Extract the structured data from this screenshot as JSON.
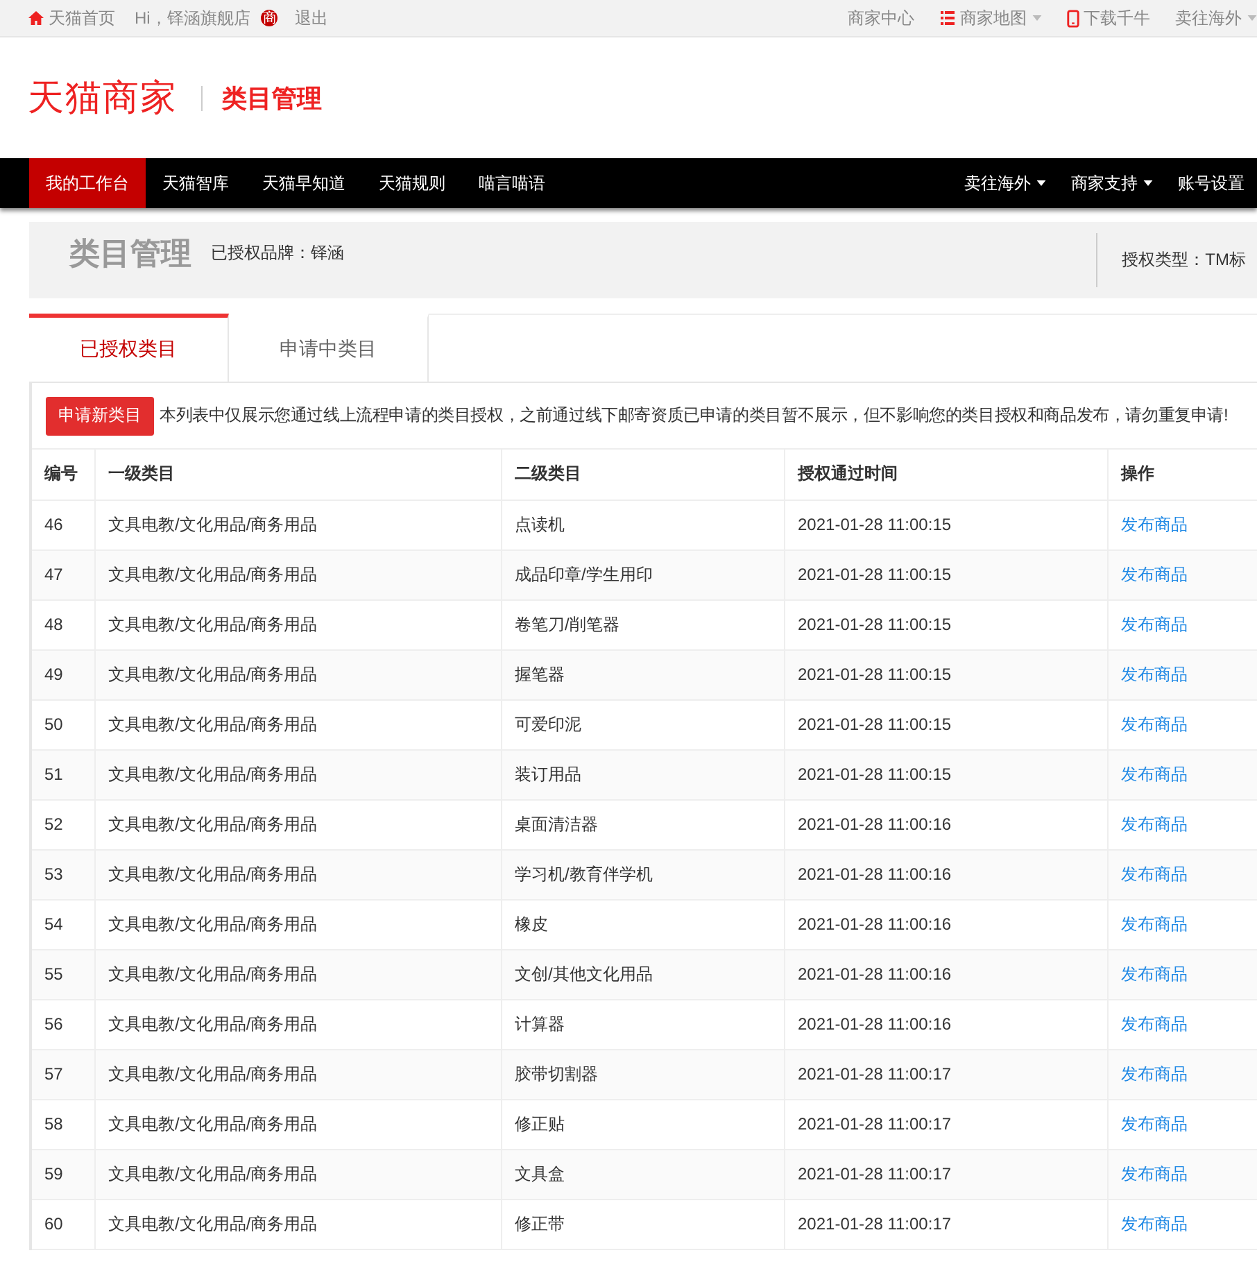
{
  "top_bar": {
    "left": [
      {
        "kind": "home",
        "label": "天猫首页"
      },
      {
        "kind": "text",
        "label": "Hi，铎涵旗舰店"
      },
      {
        "kind": "badge",
        "label": "商"
      },
      {
        "kind": "text",
        "label": "退出"
      }
    ],
    "right": [
      {
        "kind": "text",
        "label": "商家中心",
        "dropdown": false
      },
      {
        "kind": "list",
        "label": "商家地图",
        "dropdown": true
      },
      {
        "kind": "phone",
        "label": "下载千牛",
        "dropdown": false
      },
      {
        "kind": "text",
        "label": "卖往海外",
        "dropdown": true
      }
    ]
  },
  "header": {
    "logo": "天猫商家",
    "title": "类目管理"
  },
  "nav": {
    "left": [
      {
        "label": "我的工作台",
        "selected": true
      },
      {
        "label": "天猫智库",
        "selected": false
      },
      {
        "label": "天猫早知道",
        "selected": false
      },
      {
        "label": "天猫规则",
        "selected": false
      },
      {
        "label": "喵言喵语",
        "selected": false
      }
    ],
    "right": [
      {
        "label": "卖往海外",
        "dropdown": true
      },
      {
        "label": "商家支持",
        "dropdown": true
      },
      {
        "label": "账号设置",
        "dropdown": false
      }
    ]
  },
  "page_header": {
    "title": "类目管理",
    "brand": "已授权品牌：铎涵",
    "auth_type": "授权类型：TM标"
  },
  "tabs": [
    {
      "label": "已授权类目",
      "selected": true
    },
    {
      "label": "申请中类目",
      "selected": false
    }
  ],
  "apply_button": "申请新类目",
  "notice": "本列表中仅展示您通过线上流程申请的类目授权，之前通过线下邮寄资质已申请的类目暂不展示，但不影响您的类目授权和商品发布，请勿重复申请!",
  "table": {
    "columns": [
      "编号",
      "一级类目",
      "二级类目",
      "授权通过时间",
      "操作"
    ],
    "rows": [
      [
        "46",
        "文具电教/文化用品/商务用品",
        "点读机",
        "2021-01-28 11:00:15",
        "发布商品"
      ],
      [
        "47",
        "文具电教/文化用品/商务用品",
        "成品印章/学生用印",
        "2021-01-28 11:00:15",
        "发布商品"
      ],
      [
        "48",
        "文具电教/文化用品/商务用品",
        "卷笔刀/削笔器",
        "2021-01-28 11:00:15",
        "发布商品"
      ],
      [
        "49",
        "文具电教/文化用品/商务用品",
        "握笔器",
        "2021-01-28 11:00:15",
        "发布商品"
      ],
      [
        "50",
        "文具电教/文化用品/商务用品",
        "可爱印泥",
        "2021-01-28 11:00:15",
        "发布商品"
      ],
      [
        "51",
        "文具电教/文化用品/商务用品",
        "装订用品",
        "2021-01-28 11:00:15",
        "发布商品"
      ],
      [
        "52",
        "文具电教/文化用品/商务用品",
        "桌面清洁器",
        "2021-01-28 11:00:16",
        "发布商品"
      ],
      [
        "53",
        "文具电教/文化用品/商务用品",
        "学习机/教育伴学机",
        "2021-01-28 11:00:16",
        "发布商品"
      ],
      [
        "54",
        "文具电教/文化用品/商务用品",
        "橡皮",
        "2021-01-28 11:00:16",
        "发布商品"
      ],
      [
        "55",
        "文具电教/文化用品/商务用品",
        "文创/其他文化用品",
        "2021-01-28 11:00:16",
        "发布商品"
      ],
      [
        "56",
        "文具电教/文化用品/商务用品",
        "计算器",
        "2021-01-28 11:00:16",
        "发布商品"
      ],
      [
        "57",
        "文具电教/文化用品/商务用品",
        "胶带切割器",
        "2021-01-28 11:00:17",
        "发布商品"
      ],
      [
        "58",
        "文具电教/文化用品/商务用品",
        "修正贴",
        "2021-01-28 11:00:17",
        "发布商品"
      ],
      [
        "59",
        "文具电教/文化用品/商务用品",
        "文具盒",
        "2021-01-28 11:00:17",
        "发布商品"
      ],
      [
        "60",
        "文具电教/文化用品/商务用品",
        "修正带",
        "2021-01-28 11:00:17",
        "发布商品"
      ]
    ]
  }
}
